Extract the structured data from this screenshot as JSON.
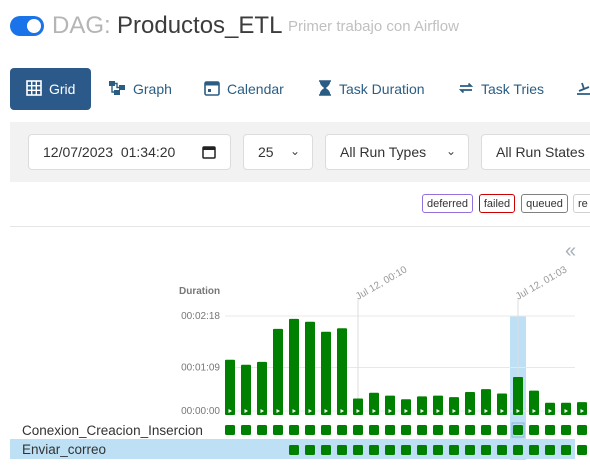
{
  "header": {
    "dag_label": "DAG:",
    "dag_name": "Productos_ETL",
    "description": "Primer trabajo con Airflow",
    "toggle_on": true
  },
  "tabs": [
    {
      "label": "Grid",
      "icon": "grid-icon",
      "active": true
    },
    {
      "label": "Graph",
      "icon": "graph-icon",
      "active": false
    },
    {
      "label": "Calendar",
      "icon": "calendar-icon",
      "active": false
    },
    {
      "label": "Task Duration",
      "icon": "hourglass-icon",
      "active": false
    },
    {
      "label": "Task Tries",
      "icon": "retry-icon",
      "active": false
    }
  ],
  "filters": {
    "date_value": "12/07/2023  01:34:20",
    "num_runs": "25",
    "run_type": "All Run Types",
    "run_state": "All Run States"
  },
  "state_legend": [
    "deferred",
    "failed",
    "queued",
    "re"
  ],
  "state_colors": {
    "success": "#008000",
    "deferred": "#9370db",
    "failed": "#cc0000",
    "queued": "#808080",
    "selected": "#bde0f5"
  },
  "grid": {
    "duration_label": "Duration",
    "y_ticks": [
      "00:02:18",
      "00:01:09",
      "00:00:00"
    ],
    "date_marks": [
      "Jul 12, 00:10",
      "Jul 12, 01:03"
    ],
    "max_seconds": 138,
    "run_durations": [
      77,
      70,
      74,
      120,
      134,
      130,
      116,
      121,
      23,
      31,
      27,
      22,
      26,
      27,
      25,
      32,
      36,
      30,
      53,
      34,
      17,
      17,
      18
    ],
    "selected_run_index": 18,
    "tasks": [
      {
        "name": "Conexion_Creacion_Insercion",
        "runs_present": 23
      },
      {
        "name": "Enviar_correo",
        "runs_present": 19
      }
    ],
    "selected_task_index": 1
  }
}
